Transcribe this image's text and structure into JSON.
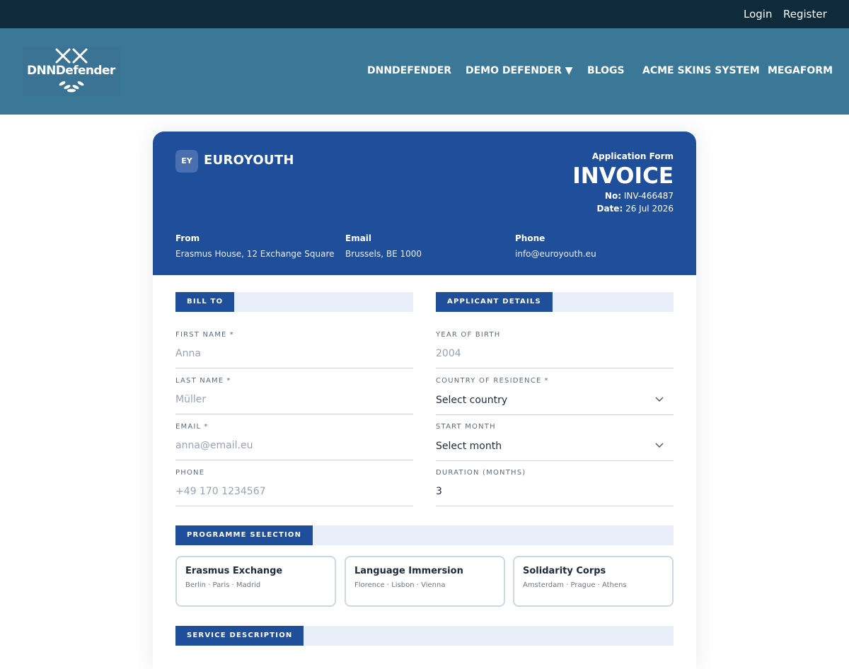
{
  "topbar": {
    "login": "Login",
    "register": "Register"
  },
  "logo": {
    "text": "DNNDefender"
  },
  "nav": {
    "items": [
      "DNNDEFENDER",
      "DEMO DEFENDER ▼",
      "BLOGS",
      "ACME SKINS SYSTEM",
      "MEGAFORM"
    ]
  },
  "invoice": {
    "badge": "EY",
    "brand": "EUROYOUTH",
    "form_type": "Application Form",
    "title": "INVOICE",
    "no_label": "No:",
    "no_value": "INV-466487",
    "date_label": "Date:",
    "date_value": "26 Jul 2026",
    "info": [
      {
        "label": "From",
        "value": "Erasmus House, 12 Exchange Square"
      },
      {
        "label": "Email",
        "value": "Brussels, BE 1000"
      },
      {
        "label": "Phone",
        "value": "info@euroyouth.eu"
      }
    ]
  },
  "sections": {
    "bill_to": "BILL TO",
    "applicant": "APPLICANT DETAILS",
    "programme": "PROGRAMME SELECTION",
    "service": "SERVICE DESCRIPTION"
  },
  "bill_fields": [
    {
      "label": "FIRST NAME",
      "required": "*",
      "placeholder": "Anna"
    },
    {
      "label": "LAST NAME",
      "required": "*",
      "placeholder": "Müller"
    },
    {
      "label": "EMAIL",
      "required": "*",
      "placeholder": "anna@email.eu"
    },
    {
      "label": "PHONE",
      "required": "",
      "placeholder": "+49 170 1234567"
    }
  ],
  "applicant_fields": {
    "year_label": "YEAR OF BIRTH",
    "year_placeholder": "2004",
    "country_label": "COUNTRY OF RESIDENCE",
    "country_required": "*",
    "country_value": "Select country",
    "start_label": "START MONTH",
    "start_value": "Select month",
    "duration_label": "DURATION (MONTHS)",
    "duration_value": "3"
  },
  "programmes": [
    {
      "title": "Erasmus Exchange",
      "cities": "Berlin · Paris · Madrid"
    },
    {
      "title": "Language Immersion",
      "cities": "Florence · Lisbon · Vienna"
    },
    {
      "title": "Solidarity Corps",
      "cities": "Amsterdam · Prague · Athens"
    }
  ],
  "colors": {
    "topbar": "#0f2a3a",
    "header": "#3b7898",
    "accent": "#1f4e9a",
    "section_bg": "#e8eff9"
  },
  "icons": {
    "logo": "crossed-swords-laurel-icon",
    "select": "chevron-down-icon"
  }
}
